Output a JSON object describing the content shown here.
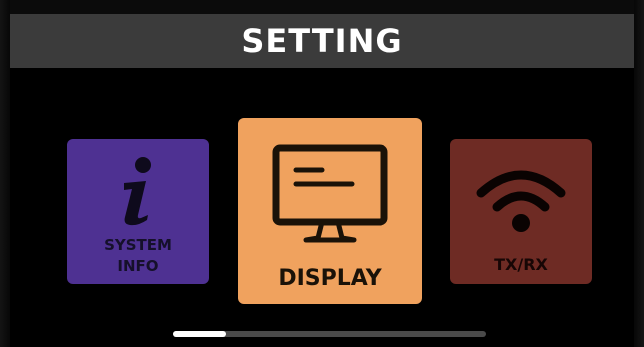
{
  "header": {
    "title": "SETTING"
  },
  "tiles": [
    {
      "id": "system-info",
      "label_lines": [
        "SYSTEM",
        "INFO"
      ],
      "icon": "info-icon",
      "color": "#4e3192",
      "selected": false
    },
    {
      "id": "display",
      "label": "DISPLAY",
      "icon": "monitor-icon",
      "color": "#f0a25e",
      "selected": true
    },
    {
      "id": "txrx",
      "label": "TX/RX",
      "icon": "wifi-icon",
      "color": "#6e2b24",
      "selected": false
    }
  ],
  "header_color": "#3b3b3b",
  "scrollbar": {
    "position": 0.0,
    "thumb_fraction": 0.17
  }
}
